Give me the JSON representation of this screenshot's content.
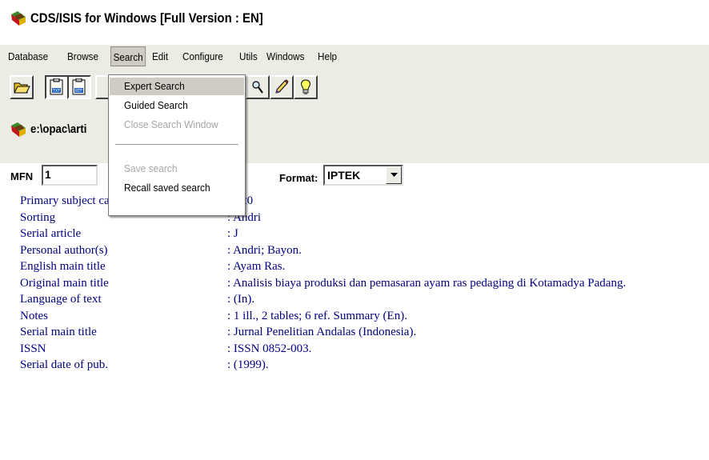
{
  "window": {
    "title": "CDS/ISIS for Windows [Full Version : EN]"
  },
  "menubar": {
    "items": [
      {
        "label": "Database"
      },
      {
        "label": "Browse"
      },
      {
        "label": "Search",
        "active": true
      },
      {
        "label": "Edit"
      },
      {
        "label": "Configure"
      },
      {
        "label": "Utils"
      },
      {
        "label": "Windows"
      },
      {
        "label": "Help"
      }
    ]
  },
  "toolbar": {
    "buttons": [
      {
        "icon": "open-folder-icon"
      },
      {
        "icon": "txt-document-icon"
      },
      {
        "icon": "rtf-document-icon"
      },
      {
        "icon": "search-icon"
      },
      {
        "icon": "edit-pencil-icon"
      },
      {
        "icon": "lightbulb-icon"
      }
    ]
  },
  "search_menu": {
    "items": [
      {
        "label": "Expert Search",
        "selected": true,
        "enabled": true
      },
      {
        "label": "Guided Search",
        "enabled": true
      },
      {
        "label": "Close Search Window",
        "enabled": false
      },
      {
        "label": "Save search",
        "enabled": false
      },
      {
        "label": "Recall saved search",
        "enabled": true
      }
    ]
  },
  "child_window": {
    "title": "e:\\opac\\artik"
  },
  "record": {
    "mfn_label": "MFN",
    "mfn_value": "1",
    "format_label": "Format:",
    "format_value": "IPTEK",
    "fields": [
      {
        "label": "Primary subject category",
        "value": ": E20"
      },
      {
        "label": "Sorting",
        "value": ": Andri"
      },
      {
        "label": "Serial article",
        "value": ": J"
      },
      {
        "label": "Personal author(s)",
        "value": ": Andri; Bayon."
      },
      {
        "label": "English main title",
        "value": ": Ayam Ras."
      },
      {
        "label": "Original main title",
        "value": ": Analisis biaya produksi dan pemasaran ayam ras pedaging di Kotamadya Padang."
      },
      {
        "label": "Language of text",
        "value": ": (In)."
      },
      {
        "label": "Notes",
        "value": ": 1 ill., 2 tables; 6 ref. Summary (En)."
      },
      {
        "label": "Serial main title",
        "value": ": Jurnal Penelitian Andalas (Indonesia)."
      },
      {
        "label": "ISSN",
        "value": ": ISSN 0852-003."
      },
      {
        "label": "Serial date of pub.",
        "value": ": (1999)."
      }
    ]
  }
}
